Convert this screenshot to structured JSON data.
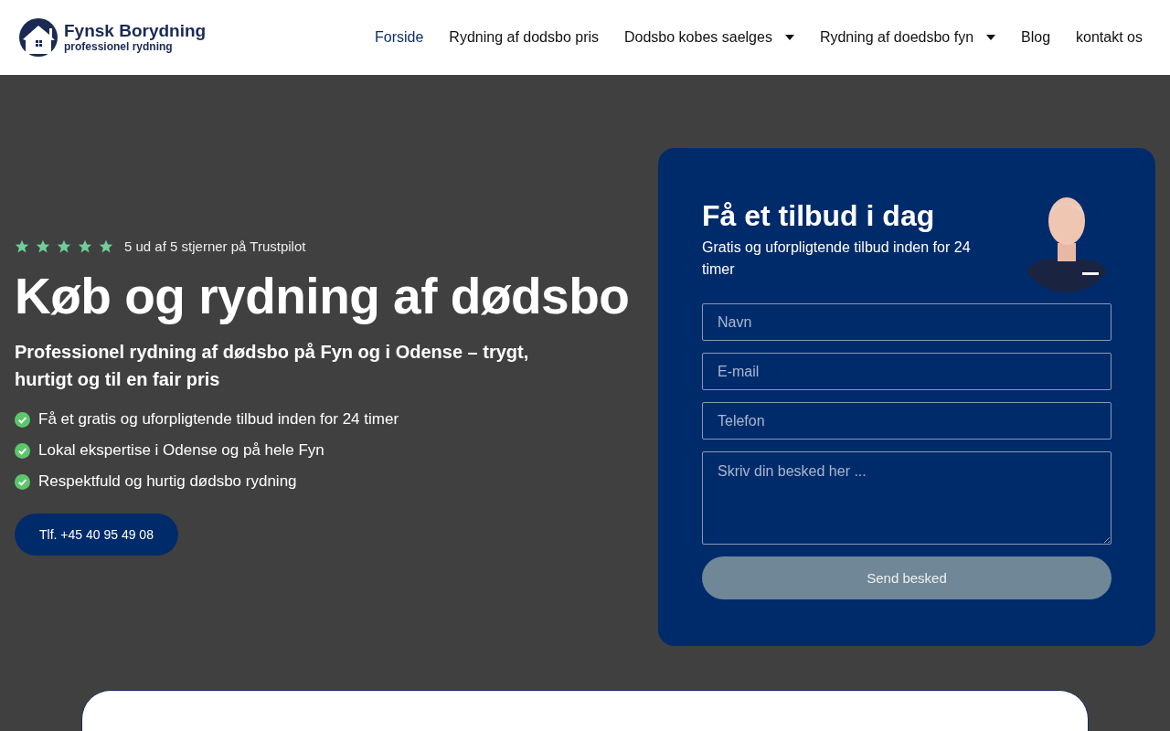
{
  "header": {
    "logo": {
      "name": "Fynsk Borydning",
      "tagline": "professionel rydning"
    },
    "nav": [
      {
        "label": "Forside",
        "selected": true,
        "dropdown": false
      },
      {
        "label": "Rydning af dodsbo pris",
        "selected": false,
        "dropdown": false
      },
      {
        "label": "Dodsbo kobes saelges",
        "selected": false,
        "dropdown": true
      },
      {
        "label": "Rydning af doedsbo fyn",
        "selected": false,
        "dropdown": true
      },
      {
        "label": "Blog",
        "selected": false,
        "dropdown": false
      },
      {
        "label": "kontakt os",
        "selected": false,
        "dropdown": false
      }
    ]
  },
  "hero": {
    "rating": {
      "stars": 5,
      "text": "5 ud af 5 stjerner på Trustpilot"
    },
    "title": "Køb og rydning af dødsbo",
    "subtitle": "Professionel rydning af dødsbo på Fyn og i Odense – trygt, hurtigt og til en fair pris",
    "benefits": [
      "Få et gratis og uforpligtende tilbud inden for 24 timer",
      "Lokal ekspertise i Odense og på hele Fyn",
      "Respektfuld og hurtig dødsbo rydning"
    ],
    "phone_button": "Tlf. +45 40 95 49 08"
  },
  "form": {
    "title": "Få et tilbud i dag",
    "subtitle": "Gratis og uforpligtende tilbud inden for 24 timer",
    "fields": [
      {
        "kind": "input",
        "placeholder": "Navn"
      },
      {
        "kind": "input",
        "placeholder": "E-mail"
      },
      {
        "kind": "input",
        "placeholder": "Telefon"
      },
      {
        "kind": "textarea",
        "placeholder": "Skriv din besked her ..."
      }
    ],
    "submit": "Send besked"
  }
}
